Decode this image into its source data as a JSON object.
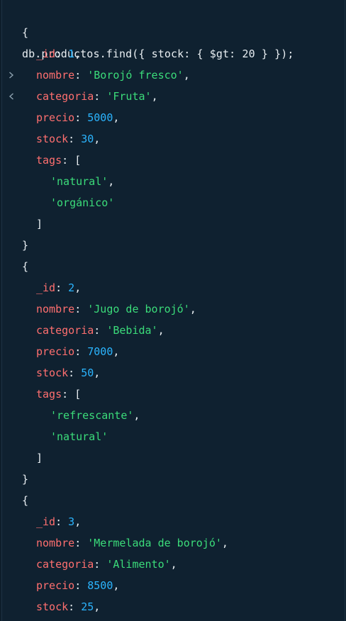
{
  "command": "db.productos.find({ stock: { $gt: 20 } });",
  "punct": {
    "open_brace": "{",
    "close_brace": "}",
    "open_bracket": "[",
    "close_bracket": "]",
    "colon": ": ",
    "comma": ","
  },
  "keys": {
    "id": "_id",
    "nombre": "nombre",
    "categoria": "categoria",
    "precio": "precio",
    "stock": "stock",
    "tags": "tags"
  },
  "documents": [
    {
      "id": "1",
      "nombre": "'Borojó fresco'",
      "categoria": "'Fruta'",
      "precio": "5000",
      "stock": "30",
      "tags": [
        "'natural'",
        "'orgánico'"
      ]
    },
    {
      "id": "2",
      "nombre": "'Jugo de borojó'",
      "categoria": "'Bebida'",
      "precio": "7000",
      "stock": "50",
      "tags": [
        "'refrescante'",
        "'natural'"
      ]
    },
    {
      "id": "3",
      "nombre": "'Mermelada de borojó'",
      "categoria": "'Alimento'",
      "precio": "8500",
      "stock": "25"
    }
  ],
  "colors": {
    "background": "#0f2130",
    "key": "#ff6f6f",
    "number": "#2bb5ff",
    "string": "#3bdc7a",
    "text": "#e8eef2",
    "icon": "#8ea2b0"
  },
  "icons": {
    "prompt": "chevron-right-icon",
    "result": "chevron-left-icon"
  }
}
